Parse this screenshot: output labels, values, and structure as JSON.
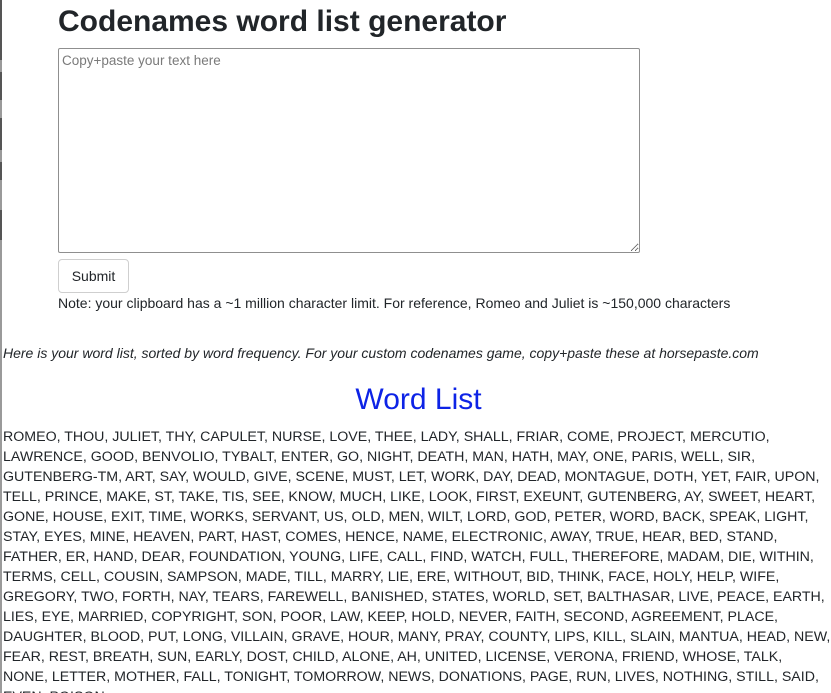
{
  "header": {
    "title": "Codenames word list generator"
  },
  "form": {
    "placeholder": "Copy+paste your text here",
    "value": "",
    "submit_label": "Submit",
    "note": "Note: your clipboard has a ~1 million character limit. For reference, Romeo and Juliet is ~150,000 characters"
  },
  "results": {
    "intro": "Here is your word list, sorted by word frequency. For your custom codenames game, copy+paste these at horsepaste.com",
    "heading": "Word List",
    "words": "ROMEO, THOU, JULIET, THY, CAPULET, NURSE, LOVE, THEE, LADY, SHALL, FRIAR, COME, PROJECT, MERCUTIO, LAWRENCE, GOOD, BENVOLIO, TYBALT, ENTER, GO, NIGHT, DEATH, MAN, HATH, MAY, ONE, PARIS, WELL, SIR, GUTENBERG-TM, ART, SAY, WOULD, GIVE, SCENE, MUST, LET, WORK, DAY, DEAD, MONTAGUE, DOTH, YET, FAIR, UPON, TELL, PRINCE, MAKE, ST, TAKE, TIS, SEE, KNOW, MUCH, LIKE, LOOK, FIRST, EXEUNT, GUTENBERG, AY, SWEET, HEART, GONE, HOUSE, EXIT, TIME, WORKS, SERVANT, US, OLD, MEN, WILT, LORD, GOD, PETER, WORD, BACK, SPEAK, LIGHT, STAY, EYES, MINE, HEAVEN, PART, HAST, COMES, HENCE, NAME, ELECTRONIC, AWAY, TRUE, HEAR, BED, STAND, FATHER, ER, HAND, DEAR, FOUNDATION, YOUNG, LIFE, CALL, FIND, WATCH, FULL, THEREFORE, MADAM, DIE, WITHIN, TERMS, CELL, COUSIN, SAMPSON, MADE, TILL, MARRY, LIE, ERE, WITHOUT, BID, THINK, FACE, HOLY, HELP, WIFE, GREGORY, TWO, FORTH, NAY, TEARS, FAREWELL, BANISHED, STATES, WORLD, SET, BALTHASAR, LIVE, PEACE, EARTH, LIES, EYE, MARRIED, COPYRIGHT, SON, POOR, LAW, KEEP, HOLD, NEVER, FAITH, SECOND, AGREEMENT, PLACE, DAUGHTER, BLOOD, PUT, LONG, VILLAIN, GRAVE, HOUR, MANY, PRAY, COUNTY, LIPS, KILL, SLAIN, MANTUA, HEAD, NEW, FEAR, REST, BREATH, SUN, EARLY, DOST, CHILD, ALONE, AH, UNITED, LICENSE, VERONA, FRIEND, WHOSE, TALK, NONE, LETTER, MOTHER, FALL, TONIGHT, TOMORROW, NEWS, DONATIONS, PAGE, RUN, LIVES, NOTHING, STILL, SAID, EVEN, POISON"
  },
  "colors": {
    "heading_blue": "#0d23e6",
    "text": "#212529"
  }
}
